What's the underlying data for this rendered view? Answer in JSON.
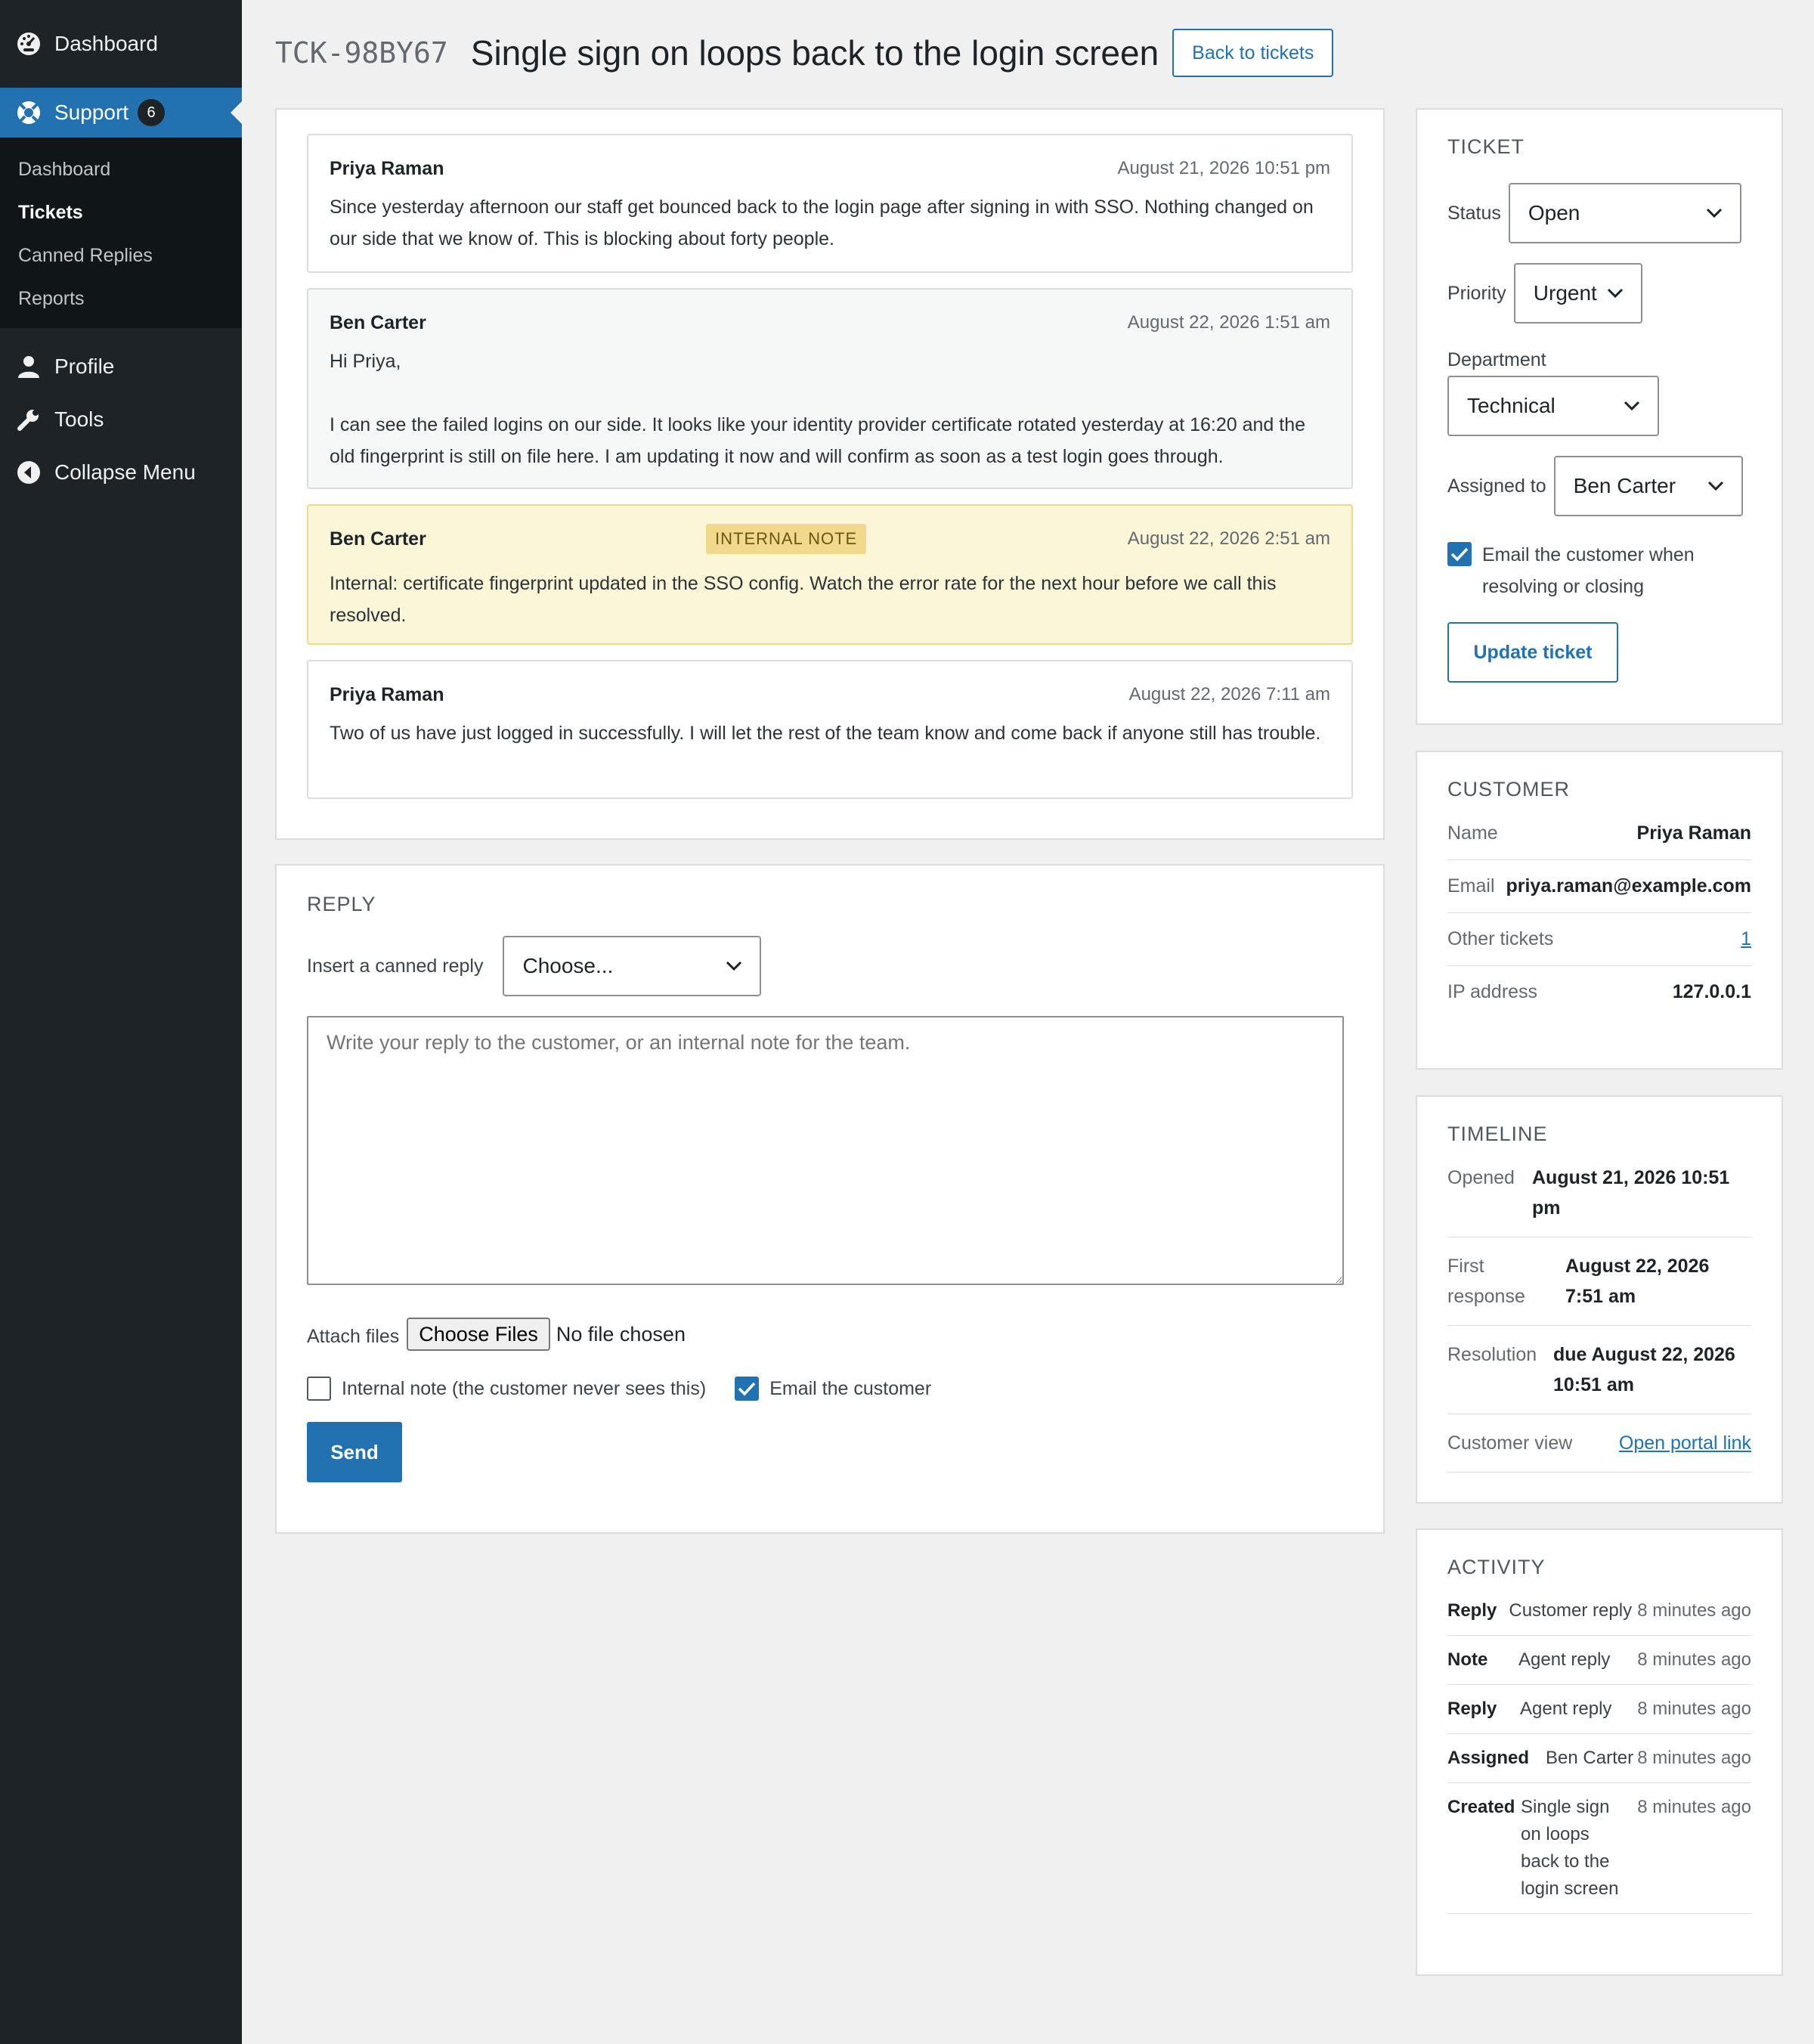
{
  "sidebar": {
    "dashboard_label": "Dashboard",
    "support_label": "Support",
    "support_badge": "6",
    "submenu": [
      "Dashboard",
      "Tickets",
      "Canned Replies",
      "Reports"
    ],
    "profile_label": "Profile",
    "tools_label": "Tools",
    "collapse_label": "Collapse Menu"
  },
  "header": {
    "ticket_id": "TCK-98BY67",
    "title": "Single sign on loops back to the login screen",
    "back_label": "Back to tickets"
  },
  "messages": [
    {
      "author": "Priya Raman",
      "date": "August 21, 2026 10:51 pm",
      "body": [
        "Since yesterday afternoon our staff get bounced back to the login page after signing in with SSO. Nothing changed on our side that we know of. This is blocking about forty people."
      ]
    },
    {
      "author": "Ben Carter",
      "date": "August 22, 2026 1:51 am",
      "body": [
        "Hi Priya,",
        "I can see the failed logins on our side. It looks like your identity provider certificate rotated yesterday at 16:20 and the old fingerprint is still on file here. I am updating it now and will confirm as soon as a test login goes through."
      ]
    },
    {
      "author": "Ben Carter",
      "badge": "INTERNAL NOTE",
      "date": "August 22, 2026 2:51 am",
      "body": [
        "Internal: certificate fingerprint updated in the SSO config. Watch the error rate for the next hour before we call this resolved."
      ]
    },
    {
      "author": "Priya Raman",
      "date": "August 22, 2026 7:11 am",
      "body": [
        "Two of us have just logged in successfully. I will let the rest of the team know and come back if anyone still has trouble."
      ]
    }
  ],
  "reply": {
    "heading": "REPLY",
    "canned_label": "Insert a canned reply",
    "canned_value": "Choose...",
    "placeholder": "Write your reply to the customer, or an internal note for the team.",
    "attach_label": "Attach files",
    "choose_files": "Choose Files",
    "no_file": "No file chosen",
    "internal_note_label": "Internal note (the customer never sees this)",
    "email_customer_label": "Email the customer",
    "send_label": "Send"
  },
  "ticket": {
    "heading": "TICKET",
    "status_label": "Status",
    "status_value": "Open",
    "priority_label": "Priority",
    "priority_value": "Urgent",
    "department_label": "Department",
    "department_value": "Technical",
    "assigned_label": "Assigned to",
    "assigned_value": "Ben Carter",
    "email_checkbox_label": "Email the customer when resolving or closing",
    "update_label": "Update ticket"
  },
  "customer": {
    "heading": "CUSTOMER",
    "name_label": "Name",
    "name": "Priya Raman",
    "email_label": "Email",
    "email": "priya.raman@example.com",
    "other_label": "Other tickets",
    "other": "1",
    "ip_label": "IP address",
    "ip": "127.0.0.1"
  },
  "timeline": {
    "heading": "TIMELINE",
    "opened_label": "Opened",
    "opened": "August 21, 2026 10:51 pm",
    "first_label": "First response",
    "first": "August 22, 2026 7:51 am",
    "resolution_label": "Resolution",
    "resolution": "due August 22, 2026 10:51 am",
    "view_label": "Customer view",
    "view_link": "Open portal link"
  },
  "activity": {
    "heading": "ACTIVITY",
    "items": [
      {
        "type": "Reply",
        "detail": "Customer reply",
        "when": "8 minutes ago"
      },
      {
        "type": "Note",
        "detail": "Agent reply",
        "when": "8 minutes ago"
      },
      {
        "type": "Reply",
        "detail": "Agent reply",
        "when": "8 minutes ago"
      },
      {
        "type": "Assigned",
        "detail": "Ben Carter",
        "when": "8 minutes ago"
      },
      {
        "type": "Created",
        "detail": "Single sign on loops back to the login screen",
        "when": "8 minutes ago"
      }
    ]
  }
}
